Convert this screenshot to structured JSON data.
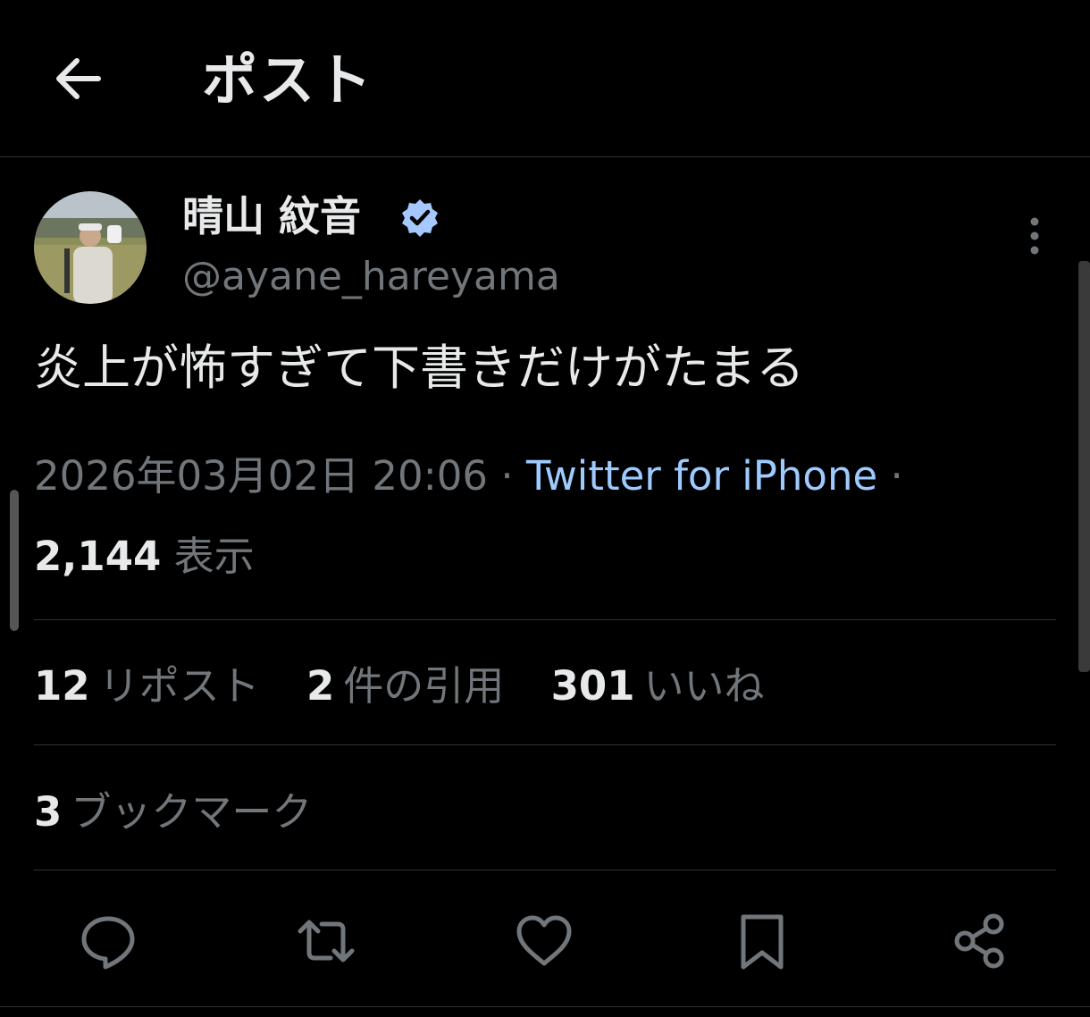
{
  "header": {
    "title": "ポスト"
  },
  "author": {
    "display_name": "晴山 紋音",
    "handle": "@ayane_hareyama",
    "verified": true
  },
  "post": {
    "text": "炎上が怖すぎて下書きだけがたまる",
    "timestamp": "2026年03月02日 20:06",
    "separator": "·",
    "source": "Twitter for iPhone",
    "views_count": "2,144",
    "views_label": "表示"
  },
  "stats": {
    "reposts_count": "12",
    "reposts_label": "リポスト",
    "quotes_count": "2",
    "quotes_label": "件の引用",
    "likes_count": "301",
    "likes_label": "いいね",
    "bookmarks_count": "3",
    "bookmarks_label": "ブックマーク"
  },
  "colors": {
    "background": "#000000",
    "text_primary": "#e7e9ea",
    "text_secondary": "#71767b",
    "link": "#9ecbff",
    "verified_badge": "#a5c8ff",
    "divider": "#2f3336"
  },
  "icons": {
    "back": "arrow-left-icon",
    "verified": "verified-badge-icon",
    "more": "more-vertical-icon",
    "reply": "reply-icon",
    "repost": "repost-icon",
    "like": "heart-icon",
    "bookmark": "bookmark-icon",
    "share": "share-icon"
  }
}
